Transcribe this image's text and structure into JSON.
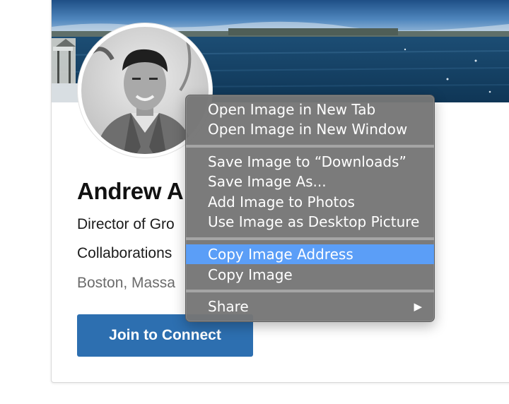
{
  "profile": {
    "name": "Andrew A",
    "headline": "Director of Gro",
    "headline_line2": "Collaborations",
    "location": "Boston, Massa",
    "join_button_label": "Join to Connect"
  },
  "context_menu": {
    "items": [
      {
        "label": "Open Image in New Tab"
      },
      {
        "label": "Open Image in New Window"
      },
      {
        "label": "Save Image to “Downloads”"
      },
      {
        "label": "Save Image As..."
      },
      {
        "label": "Add Image to Photos"
      },
      {
        "label": "Use Image as Desktop Picture"
      },
      {
        "label": "Copy Image Address",
        "highlighted": true
      },
      {
        "label": "Copy Image"
      },
      {
        "label": "Share",
        "submenu_arrow": "▶"
      }
    ]
  },
  "colors": {
    "menu_highlight": "#5b9ef7",
    "button_blue": "#2d6fb0",
    "menu_background": "#767676"
  }
}
